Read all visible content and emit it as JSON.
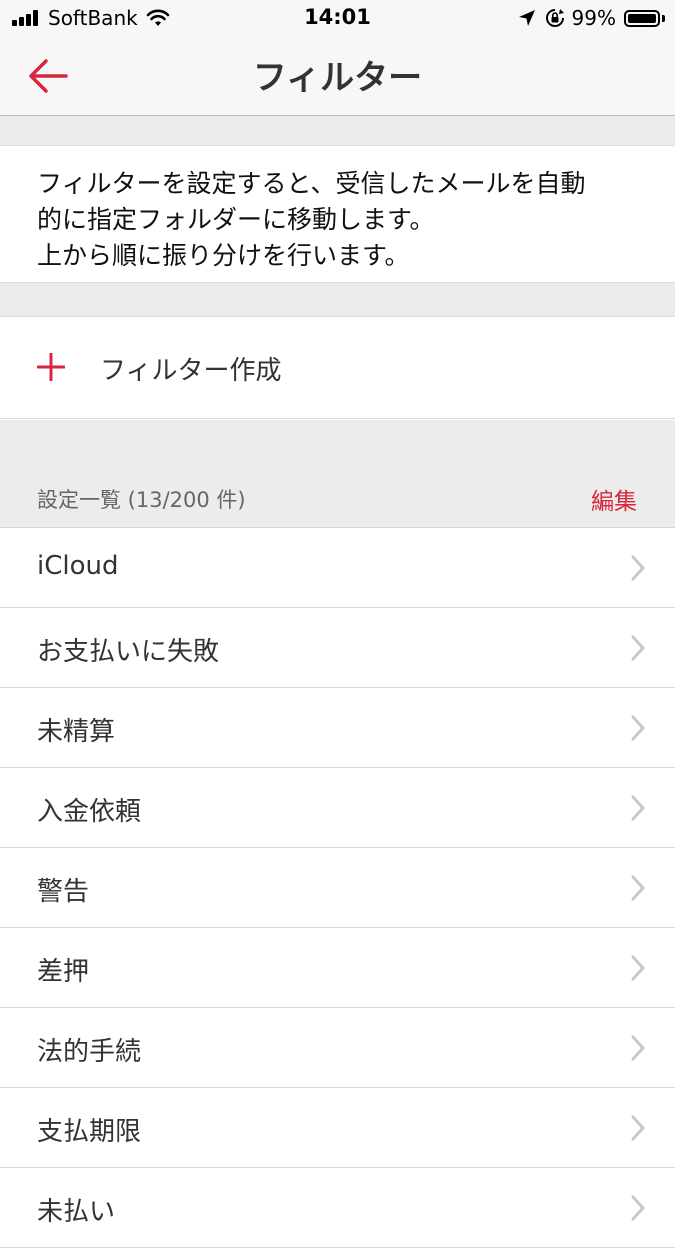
{
  "status_bar": {
    "carrier": "SoftBank",
    "time": "14:01",
    "battery_percent_text": "99%",
    "battery_level": 0.99,
    "icons": [
      "signal-bars-icon",
      "wifi-icon",
      "location-arrow-icon",
      "orientation-lock-icon",
      "battery-icon"
    ]
  },
  "nav": {
    "title": "フィルター",
    "back_icon": "back-arrow-icon"
  },
  "description": {
    "lines": [
      "フィルターを設定すると、受信したメールを自動",
      "的に指定フォルダーに移動します。",
      "上から順に振り分けを行います。"
    ]
  },
  "create": {
    "icon": "plus-icon",
    "label": "フィルター作成"
  },
  "list": {
    "header": "設定一覧 (13/200 件)",
    "edit_label": "編集",
    "items": [
      {
        "label": "iCloud"
      },
      {
        "label": "お支払いに失敗"
      },
      {
        "label": "未精算"
      },
      {
        "label": "入金依頼"
      },
      {
        "label": "警告"
      },
      {
        "label": "差押"
      },
      {
        "label": "法的手続"
      },
      {
        "label": "支払期限"
      },
      {
        "label": "未払い"
      }
    ]
  },
  "colors": {
    "accent": "#d7263d",
    "bar_background": "#f7f7f7",
    "section_gap": "#ececec",
    "chevron": "#c7c7cc"
  }
}
